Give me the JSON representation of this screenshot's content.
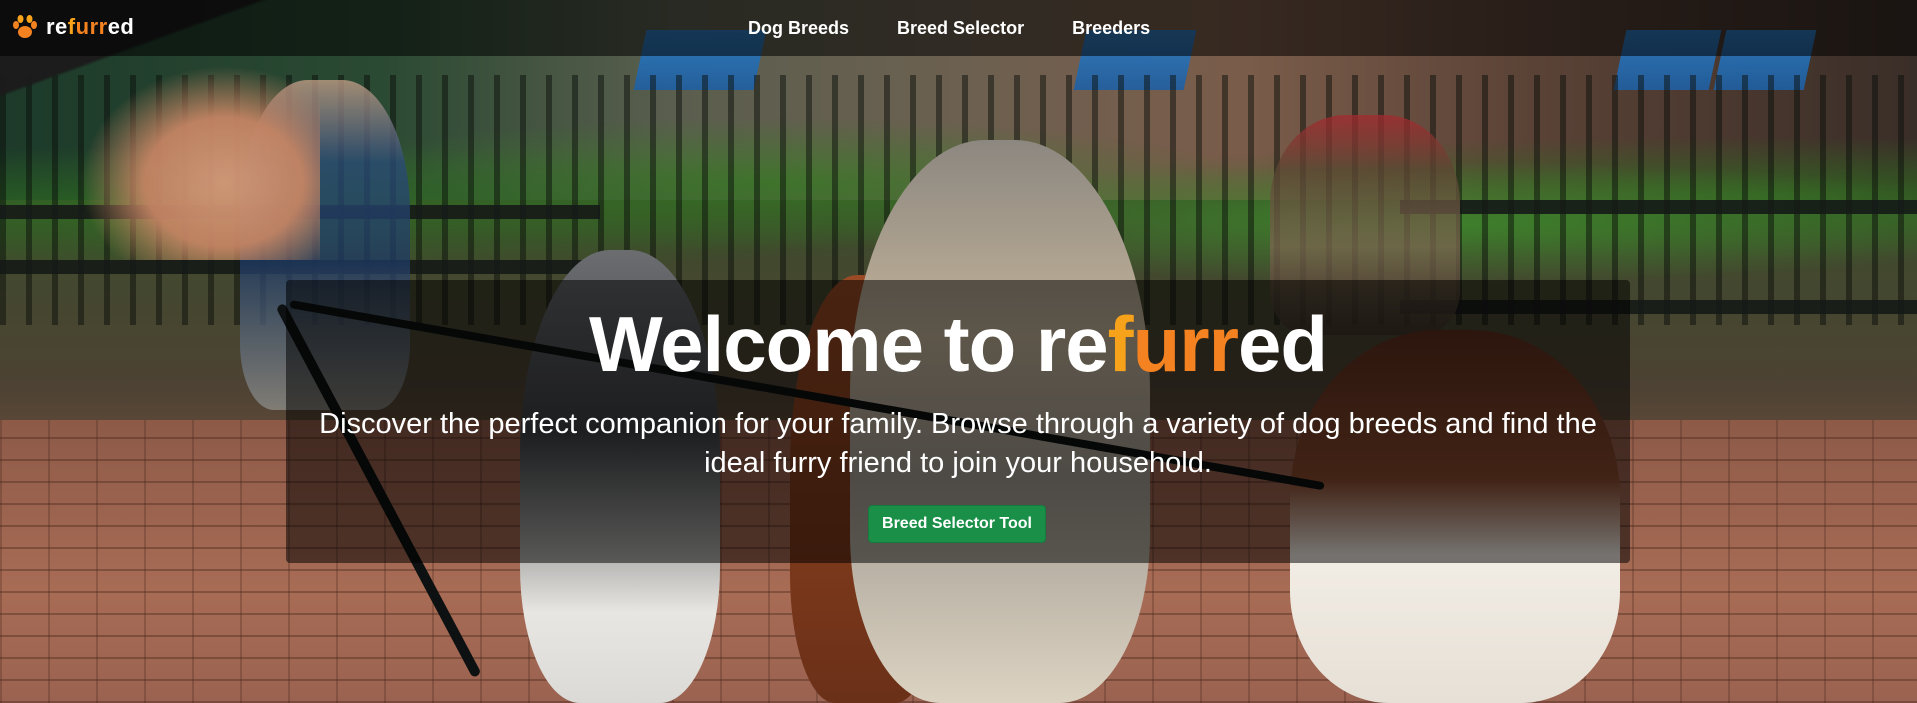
{
  "brand": {
    "prefix": "re",
    "accent_1": "f",
    "accent_2": "urr",
    "suffix": "ed",
    "icon": "paw-icon",
    "accent_color_1": "#f7a21b",
    "accent_color_2": "#f58220"
  },
  "nav": {
    "items": [
      {
        "label": "Dog Breeds"
      },
      {
        "label": "Breed Selector"
      },
      {
        "label": "Breeders"
      }
    ]
  },
  "hero": {
    "title_prefix": "Welcome to re",
    "title_accent_1": "f",
    "title_accent_2": "urr",
    "title_suffix": "ed",
    "subtitle": "Discover the perfect companion for your family. Browse through a variety of dog breeds and find the ideal furry friend to join your household.",
    "cta_label": "Breed Selector Tool",
    "cta_color": "#1a8f48"
  }
}
